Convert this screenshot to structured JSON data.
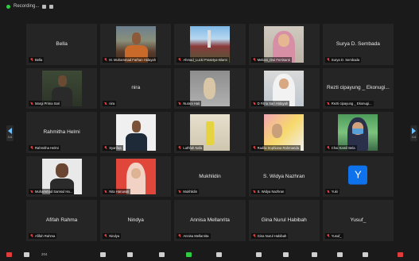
{
  "topbar": {
    "recording_label": "Recording..."
  },
  "pager": {
    "left_page": "1/4",
    "right_page": "1/4"
  },
  "tiles": [
    {
      "name": "Bella",
      "label": "Bella",
      "type": "name"
    },
    {
      "name": "",
      "label": "M. Muhammad Farhan Hidayah",
      "type": "video",
      "video": "man1"
    },
    {
      "name": "",
      "label": "Ahmad_Lucki Prasetya-Islami",
      "type": "video",
      "video": "crowd"
    },
    {
      "name": "",
      "label": "Meliani_Dwi Ferrisanti",
      "type": "video",
      "video": "hijab1"
    },
    {
      "name": "Surya D. Sembada",
      "label": "Surya D. Sembada",
      "type": "name"
    },
    {
      "name": "",
      "label": "Margi Prima Sari",
      "type": "video",
      "video": "man2"
    },
    {
      "name": "nira",
      "label": "nira",
      "type": "name"
    },
    {
      "name": "",
      "label": "Nurani Hati",
      "type": "video",
      "video": "blur"
    },
    {
      "name": "",
      "label": "D Fitria Sari Hidayah",
      "type": "video",
      "video": "hijab2"
    },
    {
      "name": "Rezti cipayung _ Ekonugi...",
      "label": "Rezti cipayung _ Ekonugi...",
      "type": "name"
    },
    {
      "name": "Rahmitha Helmi",
      "label": "Rahmitha Helmi",
      "type": "name"
    },
    {
      "name": "",
      "label": "Syarifaa",
      "type": "video",
      "video": "man3"
    },
    {
      "name": "",
      "label": "Luthfah Nafa",
      "type": "video",
      "video": "drink"
    },
    {
      "name": "",
      "label": "Radila Sophiana Rahmanda",
      "type": "video",
      "video": "collage"
    },
    {
      "name": "",
      "label": "Chai Kamil Bela",
      "type": "video",
      "video": "mask"
    },
    {
      "name": "",
      "label": "Muhammad Samsul Ha...",
      "type": "video",
      "video": "man4"
    },
    {
      "name": "",
      "label": "Nita Haruwati",
      "type": "video",
      "video": "red"
    },
    {
      "name": "Mukhlidin",
      "label": "Mukhlidin",
      "type": "name"
    },
    {
      "name": "S. Widya Nazhran",
      "label": "S. Widya Nazhran",
      "type": "name"
    },
    {
      "name": "",
      "label": "Yuki",
      "type": "avatar",
      "avatar_letter": "Y"
    },
    {
      "name": "Afifah Rahma",
      "label": "Afifah Rahma",
      "type": "name"
    },
    {
      "name": "Nindya",
      "label": "Nindya",
      "type": "name"
    },
    {
      "name": "Annisa Mellanrita",
      "label": "Annisa Mellanrita",
      "type": "name"
    },
    {
      "name": "Gina Nurul Habibah",
      "label": "Gina Nurul Habibah",
      "type": "name"
    },
    {
      "name": "Yusuf_",
      "label": "Yusuf_",
      "type": "name"
    }
  ],
  "toolbar": {
    "unmute": "",
    "participants_count": "204"
  },
  "colors": {
    "avatar": "#0e72ed",
    "muted": "#e23b3b",
    "recording": "#2ecc40",
    "pager_arrow": "#6ec1ff"
  }
}
